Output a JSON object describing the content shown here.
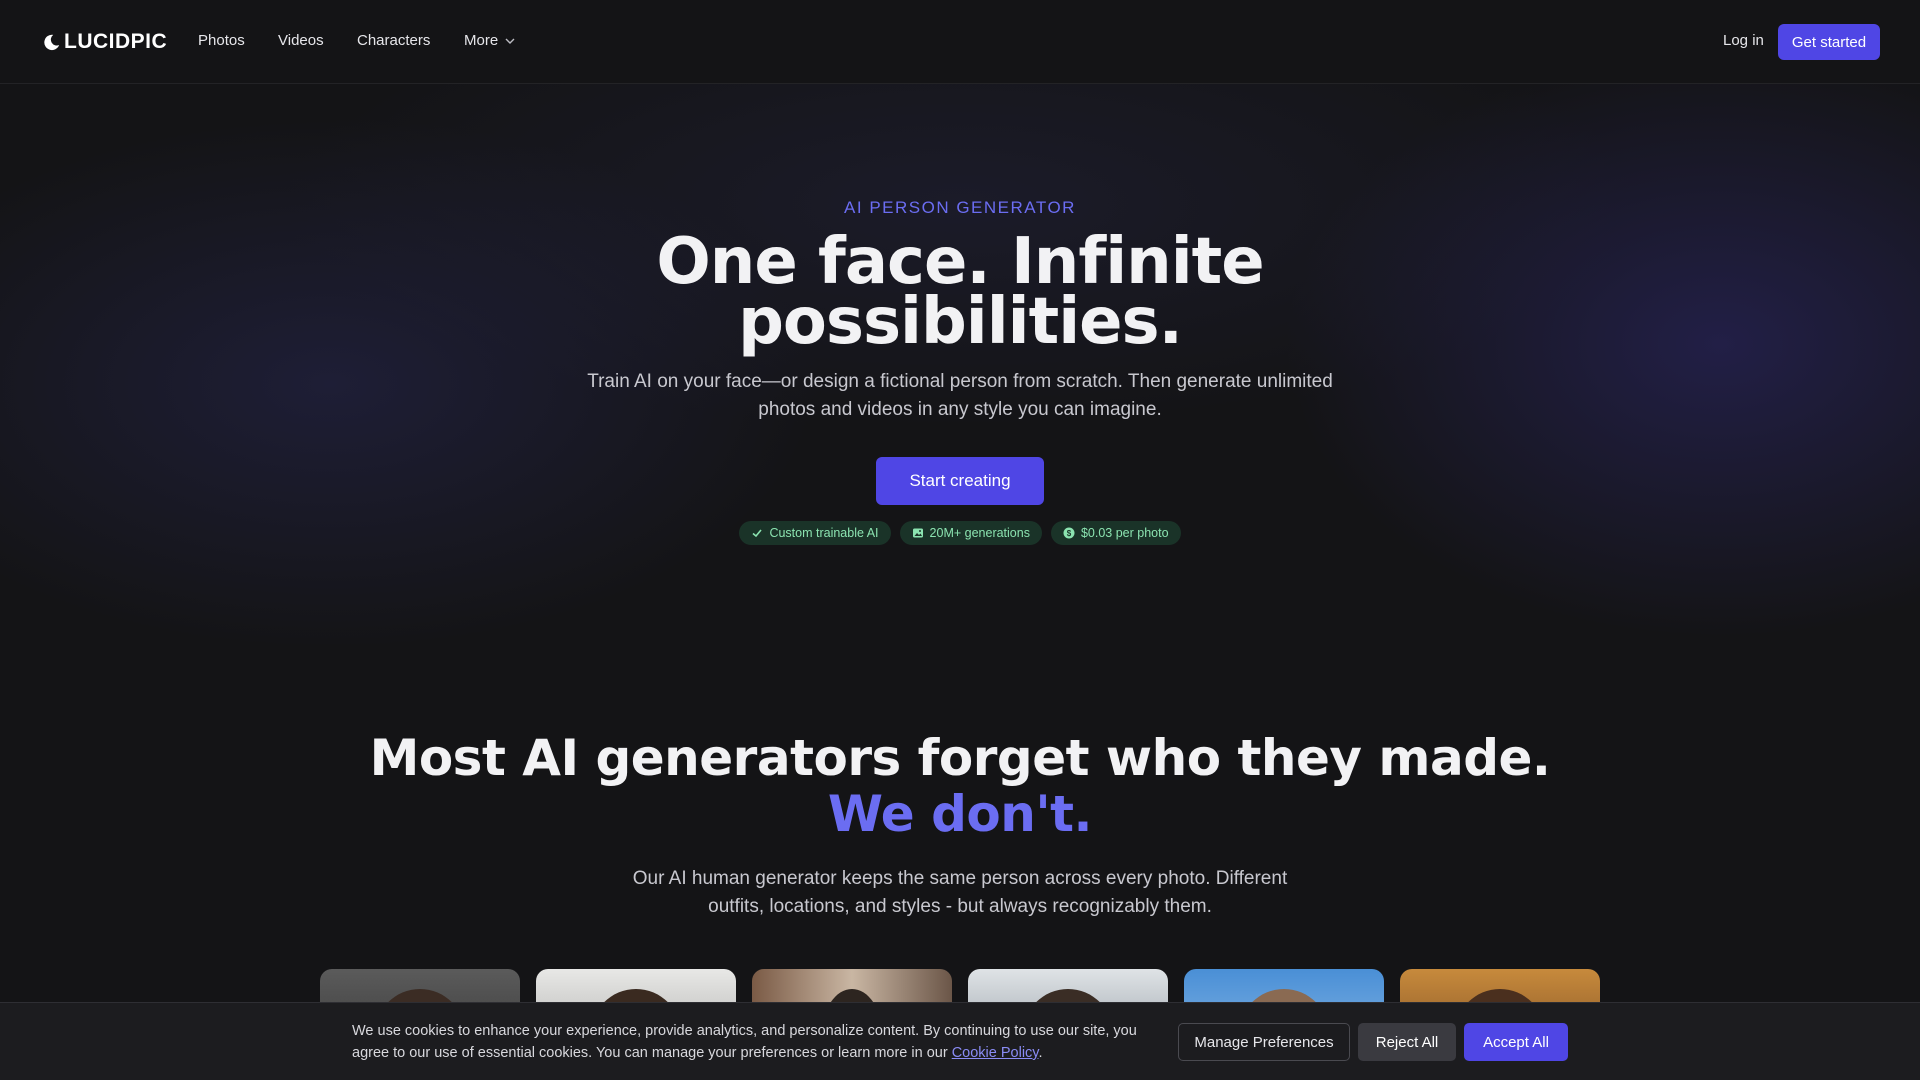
{
  "nav": {
    "logo_text": "LUCIDPIC",
    "links": [
      "Photos",
      "Videos",
      "Characters"
    ],
    "more_label": "More",
    "login_label": "Log in",
    "cta_label": "Get started"
  },
  "hero": {
    "eyebrow": "AI PERSON GENERATOR",
    "title": "One face. Infinite possibilities.",
    "subtitle": "Train AI on your face—or design a fictional person from scratch. Then generate unlimited photos and videos in any style you can imagine.",
    "cta_label": "Start creating",
    "badges": [
      {
        "icon": "check-icon",
        "label": "Custom trainable AI"
      },
      {
        "icon": "image-icon",
        "label": "20M+ generations"
      },
      {
        "icon": "dollar-icon",
        "label": "$0.03 per photo"
      }
    ]
  },
  "consistency": {
    "title": "Most AI generators forget who they made.",
    "title_accent": "We don't.",
    "subtitle": "Our AI human generator keeps the same person across every photo. Different outfits, locations, and styles - but always recognizably them."
  },
  "cookie": {
    "text": "We use cookies to enhance your experience, provide analytics, and personalize content. By continuing to use our site, you agree to our use of essential cookies. You can manage your preferences or learn more in our",
    "link_label": "Cookie Policy",
    "trailing": ".",
    "manage_label": "Manage Preferences",
    "reject_label": "Reject All",
    "accept_label": "Accept All"
  },
  "colors": {
    "accent": "#4f46e5",
    "accent_text": "#6b6df2",
    "background": "#141416",
    "badge_bg": "#1a3328",
    "badge_text": "#8be3b0"
  }
}
